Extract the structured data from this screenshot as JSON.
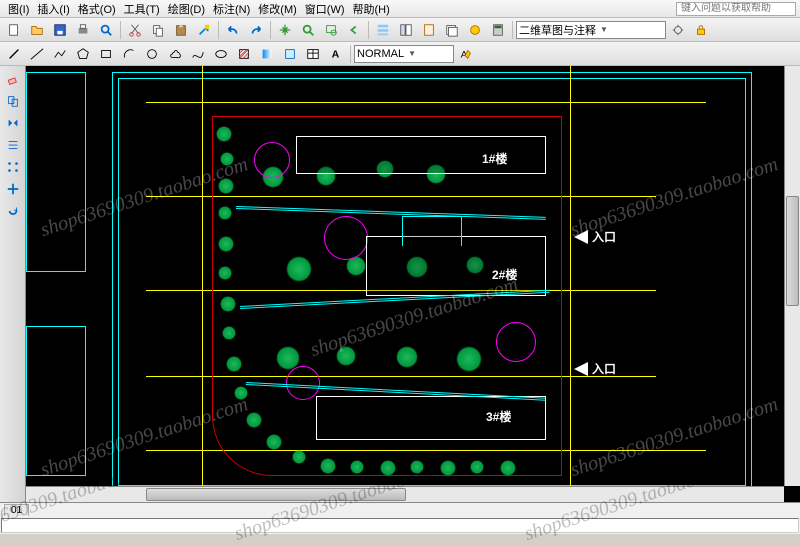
{
  "menus": [
    "图(I)",
    "插入(I)",
    "格式(O)",
    "工具(T)",
    "绘图(D)",
    "标注(N)",
    "修改(M)",
    "窗口(W)",
    "帮助(H)"
  ],
  "help_placeholder": "键入问题以获取帮助",
  "combo_layer_style": "NORMAL",
  "combo_workspace": "二维草图与注释",
  "drawing": {
    "bldg1": "1#楼",
    "bldg2": "2#楼",
    "bldg3": "3#楼",
    "entrance": "入口"
  },
  "tab_label": "01",
  "watermark_text": "shop63690309.taobao.com",
  "icons": {
    "new": "new-file-icon",
    "open": "open-icon",
    "save": "save-icon",
    "print": "print-icon",
    "cut": "cut-icon",
    "copy": "copy-icon",
    "paste": "paste-icon",
    "undo": "undo-icon",
    "redo": "redo-icon",
    "pan": "pan-icon",
    "zoom": "zoom-icon",
    "layer": "layer-icon",
    "color": "color-icon",
    "line": "line-icon",
    "rect": "rect-icon",
    "circle": "circle-icon",
    "arc": "arc-icon",
    "pline": "polyline-icon",
    "hatch": "hatch-icon",
    "text": "text-icon",
    "dim": "dimension-icon",
    "table": "table-icon",
    "match": "match-icon"
  }
}
